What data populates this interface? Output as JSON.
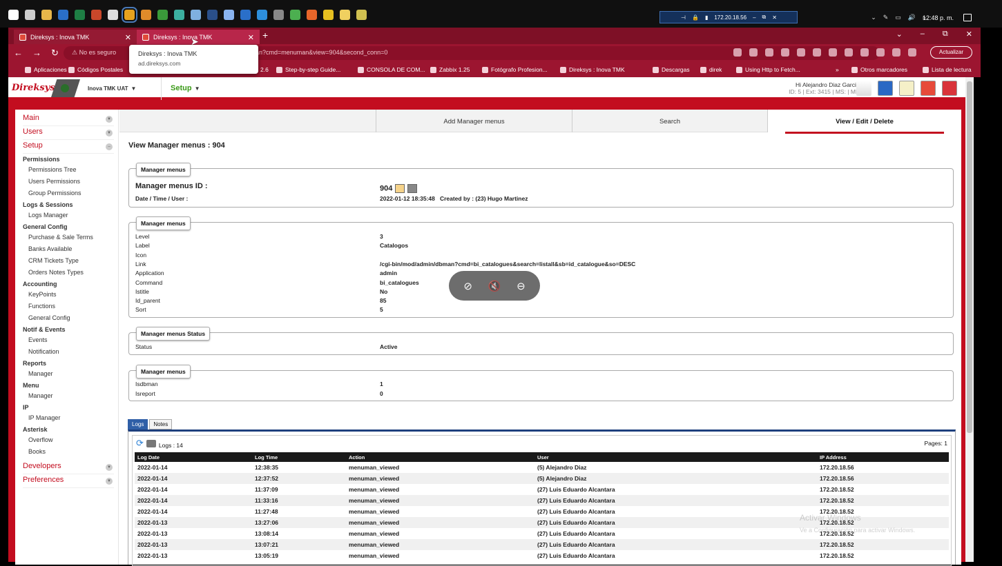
{
  "os": {
    "taskbar_icons": [
      "start-icon",
      "task-view-icon",
      "file-explorer-icon",
      "outlook-icon",
      "excel-icon",
      "powerpoint-icon",
      "qr-icon",
      "chrome-icon",
      "app-icon",
      "green-app-icon",
      "network-app-icon",
      "box-app-icon",
      "steam-icon",
      "window-icon",
      "vpn-icon",
      "vscode-icon",
      "settings-icon",
      "green-circle-icon",
      "firefox-icon",
      "chrome-canary-icon",
      "notes-icon",
      "notepad-icon"
    ],
    "remote_ip": "172.20.18.56",
    "clock": "12:48 p. m."
  },
  "browser": {
    "tabs": [
      {
        "title": "Direksys : Inova TMK"
      },
      {
        "title": "Direksys : Inova TMK"
      }
    ],
    "security_label": "No es seguro",
    "url_tail": "an?cmd=menuman&view=904&second_conn=0",
    "update_button": "Actualizar",
    "tooltip": {
      "title": "Direksys : Inova TMK",
      "domain": "ad.direksys.com"
    },
    "bookmarks": [
      {
        "label": "Aplicaciones"
      },
      {
        "label": "Códigos Postales"
      },
      {
        "label": "2.6"
      },
      {
        "label": "Step-by-step Guide..."
      },
      {
        "label": "CONSOLA DE COM..."
      },
      {
        "label": "Zabbix 1.25"
      },
      {
        "label": "Fotógrafo Profesion..."
      },
      {
        "label": "Direksys : Inova TMK"
      },
      {
        "label": "Descargas"
      },
      {
        "label": "direk"
      },
      {
        "label": "Using Http to Fetch..."
      },
      {
        "label": "»"
      },
      {
        "label": "Otros marcadores"
      },
      {
        "label": "Lista de lectura"
      }
    ]
  },
  "app": {
    "logo": "Direksys",
    "title": "Inova TMK UAT",
    "section": "Setup",
    "greeting": "Hi Alejandro Diaz Garcia!",
    "user_meta": "ID: 5 | Ext: 3415 | MS: | MP:"
  },
  "sidebar": {
    "top": [
      {
        "label": "Main"
      },
      {
        "label": "Users"
      },
      {
        "label": "Setup"
      }
    ],
    "groups": [
      {
        "title": "Permissions",
        "items": [
          "Permissions Tree",
          "Users Permissions",
          "Group Permissions"
        ]
      },
      {
        "title": "Logs & Sessions",
        "items": [
          "Logs Manager"
        ]
      },
      {
        "title": "General Config",
        "items": [
          "Purchase & Sale Terms",
          "Banks Available",
          "CRM Tickets Type",
          "Orders Notes Types"
        ]
      },
      {
        "title": "Accounting",
        "items": [
          "KeyPoints",
          "Functions",
          "General Config"
        ]
      },
      {
        "title": "Notif & Events",
        "items": [
          "Events",
          "Notification"
        ]
      },
      {
        "title": "Reports",
        "items": [
          "Manager"
        ]
      },
      {
        "title": "Menu",
        "items": [
          "Manager"
        ]
      },
      {
        "title": "IP",
        "items": [
          "IP Manager"
        ]
      },
      {
        "title": "Asterisk",
        "items": [
          "Overflow",
          "Books"
        ]
      }
    ],
    "bottom": [
      {
        "label": "Developers"
      },
      {
        "label": "Preferences"
      }
    ]
  },
  "topnav": {
    "add": "Add Manager menus",
    "search": "Search",
    "view": "View / Edit / Delete"
  },
  "page_title": "View Manager menus : 904",
  "box1": {
    "legend": "Manager menus",
    "id_label": "Manager menus ID :",
    "id_value": "904",
    "dt_label": "Date / Time / User :",
    "dt_value": "2022-01-12 18:35:48   Created by : (23) Hugo Martinez"
  },
  "box2": {
    "legend": "Manager menus",
    "rows": [
      {
        "k": "Level",
        "v": "3"
      },
      {
        "k": "Label",
        "v": "Catalogos"
      },
      {
        "k": "Icon",
        "v": ""
      },
      {
        "k": "Link",
        "v": "/cgi-bin/mod/admin/dbman?cmd=bi_catalogues&search=listall&sb=id_catalogue&so=DESC"
      },
      {
        "k": "Application",
        "v": "admin"
      },
      {
        "k": "Command",
        "v": "bi_catalogues"
      },
      {
        "k": "Istitle",
        "v": "No"
      },
      {
        "k": "Id_parent",
        "v": "85"
      },
      {
        "k": "Sort",
        "v": "5"
      }
    ]
  },
  "box3": {
    "legend": "Manager menus Status",
    "k": "Status",
    "v": "Active"
  },
  "box4": {
    "legend": "Manager menus",
    "rows": [
      {
        "k": "Isdbman",
        "v": "1"
      },
      {
        "k": "Isreport",
        "v": "0"
      }
    ]
  },
  "logs": {
    "tabs": [
      "Logs",
      "Notes"
    ],
    "count_label": "Logs : 14",
    "pages": "Pages: 1",
    "columns": [
      "Log Date",
      "Log Time",
      "Action",
      "User",
      "IP Address"
    ],
    "rows": [
      [
        "2022-01-14",
        "12:38:35",
        "menuman_viewed",
        "(5) Alejandro Diaz",
        "172.20.18.56"
      ],
      [
        "2022-01-14",
        "12:37:52",
        "menuman_viewed",
        "(5) Alejandro Diaz",
        "172.20.18.56"
      ],
      [
        "2022-01-14",
        "11:37:09",
        "menuman_viewed",
        "(27) Luis Eduardo Alcantara",
        "172.20.18.52"
      ],
      [
        "2022-01-14",
        "11:33:16",
        "menuman_viewed",
        "(27) Luis Eduardo Alcantara",
        "172.20.18.52"
      ],
      [
        "2022-01-14",
        "11:27:48",
        "menuman_viewed",
        "(27) Luis Eduardo Alcantara",
        "172.20.18.52"
      ],
      [
        "2022-01-13",
        "13:27:06",
        "menuman_viewed",
        "(27) Luis Eduardo Alcantara",
        "172.20.18.52"
      ],
      [
        "2022-01-13",
        "13:08:14",
        "menuman_viewed",
        "(27) Luis Eduardo Alcantara",
        "172.20.18.52"
      ],
      [
        "2022-01-13",
        "13:07:21",
        "menuman_viewed",
        "(27) Luis Eduardo Alcantara",
        "172.20.18.52"
      ],
      [
        "2022-01-13",
        "13:05:19",
        "menuman_viewed",
        "(27) Luis Eduardo Alcantara",
        "172.20.18.52"
      ]
    ]
  },
  "watermark": {
    "line1": "Activar Windows",
    "line2": "Ve a Configuración para activar Windows."
  },
  "colors": {
    "brand": "#c30d1f",
    "browser_bar": "#9c1530",
    "logs_tab": "#2f5fa7"
  }
}
